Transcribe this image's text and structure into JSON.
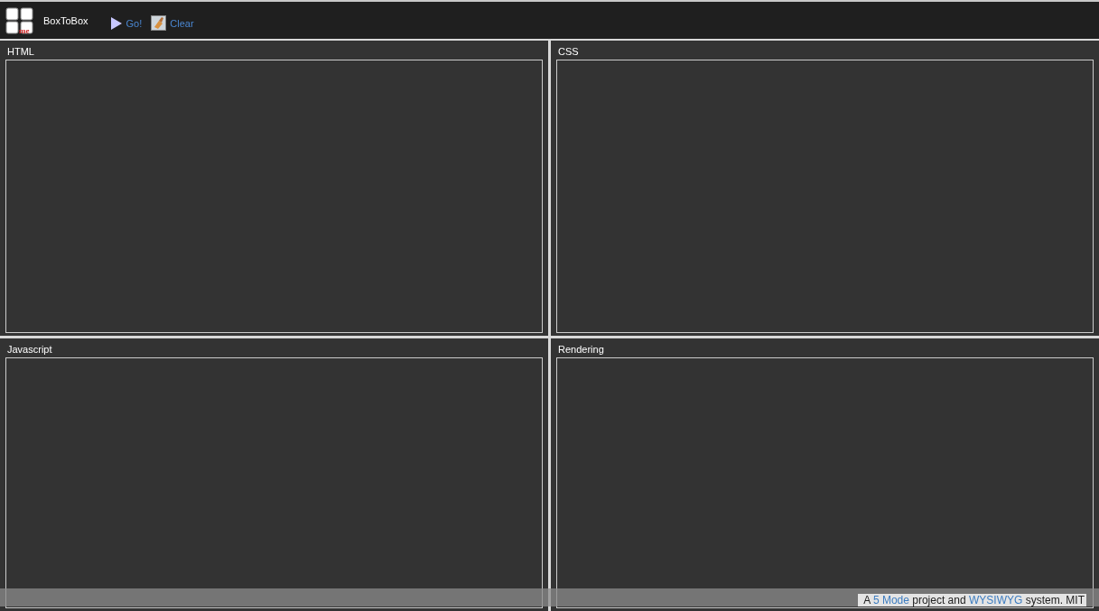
{
  "app": {
    "name": "BoxToBox",
    "logo_mark": "me"
  },
  "toolbar": [
    {
      "kind": "play",
      "label": "Go!"
    },
    {
      "kind": "clear",
      "label": "Clear"
    }
  ],
  "panels": [
    {
      "title": "HTML"
    },
    {
      "title": "CSS"
    },
    {
      "title": "Javascript"
    },
    {
      "title": "Rendering"
    }
  ],
  "footer": {
    "parts": [
      {
        "kind": "text",
        "text": "A "
      },
      {
        "kind": "link",
        "text": "5 Mode"
      },
      {
        "kind": "text",
        "text": " project and "
      },
      {
        "kind": "link",
        "text": "WYSIWYG"
      },
      {
        "kind": "text",
        "text": " system. MIT"
      }
    ]
  }
}
